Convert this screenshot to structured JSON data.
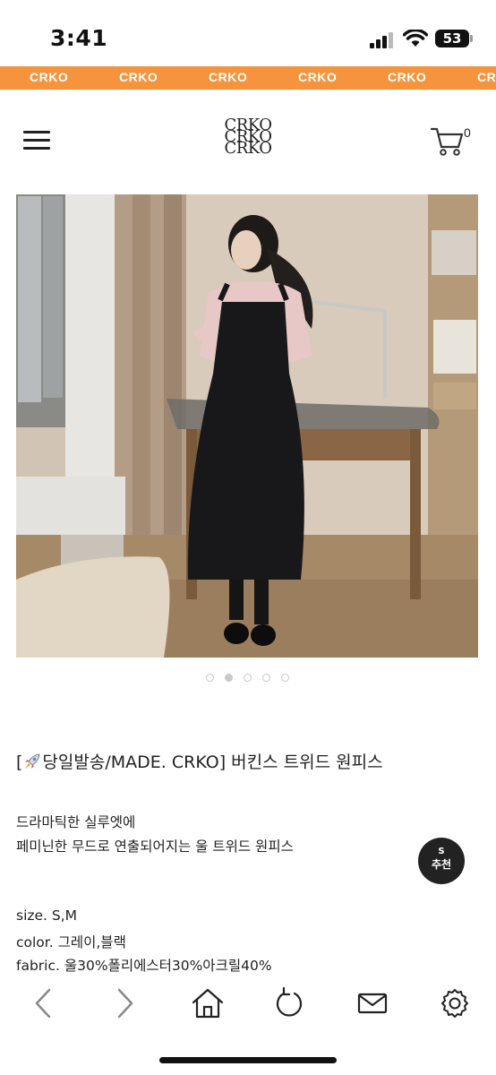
{
  "status_bar": {
    "time": "3:41",
    "battery": "53"
  },
  "promo_banner": {
    "items": [
      "CRKO",
      "CRKO",
      "CRKO",
      "CRKO",
      "CRKO",
      "CRKO"
    ]
  },
  "header": {
    "logo_lines": [
      "CRKO",
      "CRKO",
      "CRKO"
    ],
    "cart_count": "0"
  },
  "gallery": {
    "slide_count": 5,
    "active_index": 1
  },
  "product": {
    "title_prefix": "[",
    "title_main": "당일발송/MADE. CRKO] 버킨스 트위드 원피스",
    "desc_line1": "드라마틱한 실루엣에",
    "desc_line2": "페미닌한 무드로 연출되어지는 울 트위드 원피스",
    "size": "size. S,M",
    "color": "color. 그레이,블랙",
    "fabric": "fabric. 울30%폴리에스터30%아크릴40%"
  },
  "recommend": {
    "badge": "S",
    "label": "추천"
  },
  "bottom_nav": {
    "items": [
      "back-icon",
      "forward-icon",
      "home-icon",
      "refresh-icon",
      "mail-icon",
      "settings-icon"
    ]
  },
  "colors": {
    "banner": "#f5943d",
    "text": "#222222",
    "dark": "#111111"
  }
}
